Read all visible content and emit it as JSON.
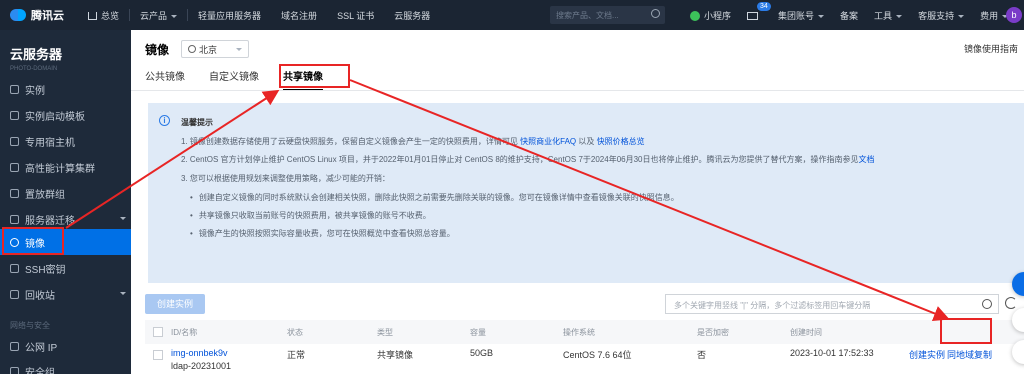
{
  "topbar": {
    "logo": "腾讯云",
    "home": "总览",
    "nav": [
      "云产品",
      "轻量应用服务器",
      "域名注册",
      "SSL 证书",
      "云服务器"
    ],
    "search_placeholder": "搜索产品、文档...",
    "mini_program": "小程序",
    "mail_count": "34",
    "account": "集团账号",
    "filing": "备案",
    "tools": "工具",
    "support": "客服支持",
    "billing": "费用",
    "avatar_letter": "b"
  },
  "sidebar": {
    "title": "云服务器",
    "subtitle": "PHOTO-DOMAIN",
    "items": [
      {
        "label": "实例"
      },
      {
        "label": "实例启动模板"
      },
      {
        "label": "专用宿主机"
      },
      {
        "label": "高性能计算集群"
      },
      {
        "label": "置放群组"
      },
      {
        "label": "服务器迁移"
      },
      {
        "label": "镜像"
      },
      {
        "label": "SSH密钥"
      },
      {
        "label": "回收站"
      }
    ],
    "section_network": "网络与安全",
    "items2": [
      {
        "label": "公网 IP"
      },
      {
        "label": "安全组"
      }
    ]
  },
  "main": {
    "title": "镜像",
    "region": "北京",
    "guide": "镜像使用指南",
    "tabs": [
      "公共镜像",
      "自定义镜像",
      "共享镜像"
    ]
  },
  "notice": {
    "title": "温馨提示",
    "line1": "1. 镜像创建数据存储使用了云硬盘快照服务，保留自定义镜像会产生一定的快照费用，详情可见",
    "line1_link1": "快照商业化FAQ",
    "line1_mid": "以及",
    "line1_link2": "快照价格总览",
    "line2_pre": "2. CentOS 官方计划停止维护 CentOS Linux 项目，并于2022年01月01日停止对 CentOS 8的维护支持，CentOS 7于2024年06月30日也将停止维护。腾讯云为您提供了替代方案，操作指南参见",
    "line2_link": "文档",
    "line3": "3. 您可以根据使用规划来调整使用策略，减少可能的开销：",
    "bullets": [
      "创建自定义镜像的同时系统默认会创建相关快照，删除此快照之前需要先删除关联的镜像。您可在镜像详情中查看镜像关联的快照信息。",
      "共享镜像只收取当前账号的快照费用，被共享镜像的账号不收费。",
      "镜像产生的快照按照实际容量收费，您可在快照概览中查看快照总容量。"
    ]
  },
  "toolbar": {
    "create_button": "创建实例",
    "search_placeholder": "多个关键字用竖线 \"|\" 分隔，多个过滤标签用回车键分隔"
  },
  "table": {
    "headers": [
      "ID/名称",
      "状态",
      "类型",
      "容量",
      "操作系统",
      "是否加密",
      "创建时间"
    ],
    "rows": [
      {
        "id": "img-onnbek9v",
        "name": "ldap-20231001",
        "status": "正常",
        "type": "共享镜像",
        "capacity": "50GB",
        "os": "CentOS 7.6 64位",
        "encrypted": "否",
        "created": "2023-10-01 17:52:33",
        "action1": "创建实例",
        "action2": "同地域复制"
      }
    ]
  },
  "colors": {
    "topbar": "#1b2533",
    "sidebar": "#1e2a3a",
    "active": "#0070e6",
    "notice_bg": "#dfeaf7",
    "link": "#0052d9",
    "annotation": "#e82525"
  }
}
